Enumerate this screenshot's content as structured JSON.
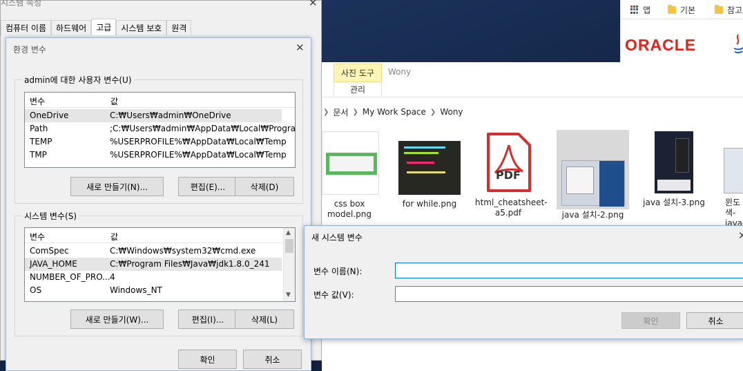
{
  "browser": {
    "bookmarks": [
      {
        "label": "앱",
        "icon": "apps-icon"
      },
      {
        "label": "기본",
        "icon": "folder-icon"
      },
      {
        "label": "참고",
        "icon": "folder-icon"
      }
    ],
    "logo_text": "ORACLE",
    "brand_color": "#e2231a"
  },
  "explorer": {
    "ribbon_tab": "사진 도구",
    "ribbon_subtab": "관리",
    "ribbon_title": "Wony",
    "breadcrumb": [
      "문서",
      "My Work Space",
      "Wony"
    ],
    "files": [
      {
        "name": "css box model.png"
      },
      {
        "name": "for while.png"
      },
      {
        "name": "html_cheatsheet-a5.pdf",
        "pdf_label": "PDF"
      },
      {
        "name": "java 설치-2.png",
        "selected": true
      },
      {
        "name": "java 설치-3.png"
      },
      {
        "name": "윈도\n색-\njava"
      }
    ]
  },
  "sysprop": {
    "title": "시스템 속성",
    "tabs": [
      "컴퓨터 이름",
      "하드웨어",
      "고급",
      "시스템 보호",
      "원격"
    ],
    "active_tab": "고급"
  },
  "env_dialog": {
    "title": "환경 변수",
    "user_group_label": "admin에 대한 사용자 변수(U)",
    "columns": [
      "변수",
      "값"
    ],
    "user_vars": [
      {
        "name": "OneDrive",
        "value": "C:₩Users₩admin₩OneDrive",
        "selected": true
      },
      {
        "name": "Path",
        "value": ";C:₩Users₩admin₩AppData₩Local₩Progra..."
      },
      {
        "name": "TEMP",
        "value": "%USERPROFILE%₩AppData₩Local₩Temp"
      },
      {
        "name": "TMP",
        "value": "%USERPROFILE%₩AppData₩Local₩Temp"
      }
    ],
    "user_buttons": {
      "new": "새로 만들기(N)...",
      "edit": "편집(E)...",
      "delete": "삭제(D)"
    },
    "system_group_label": "시스템 변수(S)",
    "system_vars": [
      {
        "name": "ComSpec",
        "value": "C:₩Windows₩system32₩cmd.exe"
      },
      {
        "name": "JAVA_HOME",
        "value": "C:₩Program Files₩Java₩jdk1.8.0_241",
        "selected": true
      },
      {
        "name": "NUMBER_OF_PRO...",
        "value": "4"
      },
      {
        "name": "OS",
        "value": "Windows_NT"
      }
    ],
    "system_buttons": {
      "new": "새로 만들기(W)...",
      "edit": "편집(I)...",
      "delete": "삭제(L)"
    },
    "ok": "확인",
    "cancel": "취소"
  },
  "new_var_dialog": {
    "title": "새 시스템 변수",
    "name_label": "변수 이름(N):",
    "name_value": "",
    "value_label": "변수 값(V):",
    "value_value": "",
    "ok": "확인",
    "cancel": "취소"
  }
}
